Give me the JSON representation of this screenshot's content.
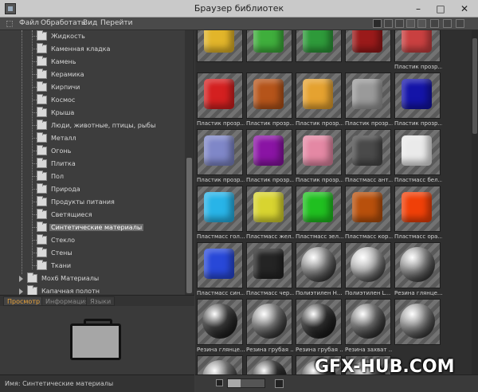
{
  "window": {
    "title": "Браузер библиотек"
  },
  "menu": [
    "Файл",
    "Обработать",
    "Вид",
    "Перейти"
  ],
  "toolbar_icons": [
    "view-mode-icon",
    "home-icon",
    "up-folder-icon",
    "grid-view-icon",
    "list-view-icon",
    "back-icon",
    "settings-icon",
    "pin-icon"
  ],
  "tree": {
    "items": [
      "Жидкость",
      "Каменная кладка",
      "Камень",
      "Керамика",
      "Кирпичи",
      "Космос",
      "Крыша",
      "Люди, животные, птицы, рыбы",
      "Металл",
      "Огонь",
      "Плитка",
      "Пол",
      "Природа",
      "Продукты питания",
      "Светящиеся",
      "Синтетические материалы",
      "Стекло",
      "Стены",
      "Ткани"
    ],
    "selected_index": 15,
    "parent_item": "Мох6   Материалы",
    "partial_item": "Капачная полотн"
  },
  "preview": {
    "tabs": [
      "Просмотр",
      "Информация",
      "Языки"
    ],
    "active_tab": 0,
    "name_label": "Имя: Синтетические материалы"
  },
  "grid": {
    "tiles": [
      {
        "label": "",
        "shape": "cube",
        "color": "#e2b52a"
      },
      {
        "label": "",
        "shape": "cube",
        "color": "#3fae3c"
      },
      {
        "label": "",
        "shape": "cube",
        "color": "#2e9a3a"
      },
      {
        "label": "",
        "shape": "cube",
        "color": "#9a1a1a"
      },
      {
        "label": "Пластик прозр...",
        "shape": "cube",
        "color": "#c94040"
      },
      {
        "label": "Пластик прозр...",
        "shape": "cube",
        "color": "#d42020"
      },
      {
        "label": "Пластик прозр...",
        "shape": "cube",
        "color": "#b5541a"
      },
      {
        "label": "Пластик прозр...",
        "shape": "cube",
        "color": "#e5a230"
      },
      {
        "label": "Пластик прозр...",
        "shape": "cube",
        "color": "#9a9a9a"
      },
      {
        "label": "Пластик прозр...",
        "shape": "cube",
        "color": "#1414a8"
      },
      {
        "label": "Пластик прозр...",
        "shape": "cube",
        "color": "#7f87c8"
      },
      {
        "label": "Пластик прозр...",
        "shape": "cube",
        "color": "#8a14a4"
      },
      {
        "label": "Пластик прозр...",
        "shape": "cube",
        "color": "#e488a4"
      },
      {
        "label": "Пластмасс ант...",
        "shape": "cube",
        "color": "#4a4a4a"
      },
      {
        "label": "Пластмасс бел...",
        "shape": "cube",
        "color": "#eaeaea"
      },
      {
        "label": "Пластмасс гол...",
        "shape": "cube",
        "color": "#28b4e8"
      },
      {
        "label": "Пластмасс жел...",
        "shape": "cube",
        "color": "#d8d430"
      },
      {
        "label": "Пластмасс зел...",
        "shape": "cube",
        "color": "#20c020"
      },
      {
        "label": "Пластмасс кор...",
        "shape": "cube",
        "color": "#b8500c"
      },
      {
        "label": "Пластмасс ора...",
        "shape": "cube",
        "color": "#f04008"
      },
      {
        "label": "Пластмасс син...",
        "shape": "cube",
        "color": "#2848d8"
      },
      {
        "label": "Пластмасс чер...",
        "shape": "cube",
        "color": "#242424"
      },
      {
        "label": "Полиэтилен Н...",
        "shape": "sphere",
        "color": "#8a8a8a"
      },
      {
        "label": "Полиэтилен L...",
        "shape": "sphere",
        "color": "#b4b4b4"
      },
      {
        "label": "Резина глянце...",
        "shape": "sphere",
        "color": "#8c8c8c"
      },
      {
        "label": "Резина глянце...",
        "shape": "sphere",
        "color": "#3a3a3a"
      },
      {
        "label": "Резина грубая ...",
        "shape": "sphere",
        "color": "#7a7a7a"
      },
      {
        "label": "Резина грубая ...",
        "shape": "sphere",
        "color": "#2e2e2e"
      },
      {
        "label": "Резина захват ...",
        "shape": "sphere",
        "color": "#6c6c6c"
      },
      {
        "label": "",
        "shape": "sphere",
        "color": "#8a8a8a"
      },
      {
        "label": "",
        "shape": "sphere",
        "color": "#6e6e6e"
      },
      {
        "label": "",
        "shape": "sphere",
        "color": "#2c2c2c"
      },
      {
        "label": "",
        "shape": "sphere",
        "color": "#3a3a3a"
      },
      {
        "label": "",
        "shape": "sphere",
        "color": "#4a4a4a"
      }
    ]
  },
  "zoom": {
    "level": 0.35
  },
  "watermark": "GFX-HUB.COM"
}
